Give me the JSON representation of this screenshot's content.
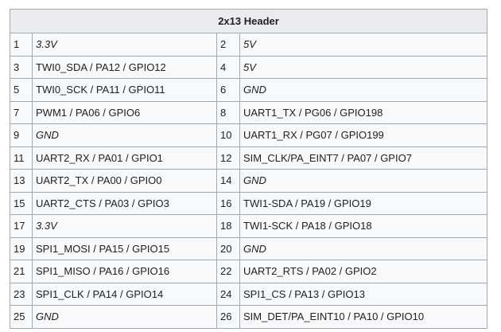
{
  "table": {
    "title": "2x13 Header",
    "rows": [
      [
        {
          "pin": "1",
          "label": "3.3V",
          "italic": true
        },
        {
          "pin": "2",
          "label": "5V",
          "italic": true
        }
      ],
      [
        {
          "pin": "3",
          "label": "TWI0_SDA / PA12 / GPIO12"
        },
        {
          "pin": "4",
          "label": "5V",
          "italic": true
        }
      ],
      [
        {
          "pin": "5",
          "label": "TWI0_SCK / PA11 / GPIO11"
        },
        {
          "pin": "6",
          "label": "GND",
          "italic": true
        }
      ],
      [
        {
          "pin": "7",
          "label": "PWM1 / PA06 / GPIO6"
        },
        {
          "pin": "8",
          "label": "UART1_TX / PG06 / GPIO198"
        }
      ],
      [
        {
          "pin": "9",
          "label": "GND",
          "italic": true
        },
        {
          "pin": "10",
          "label": "UART1_RX / PG07 / GPIO199"
        }
      ],
      [
        {
          "pin": "11",
          "label": "UART2_RX / PA01 / GPIO1"
        },
        {
          "pin": "12",
          "label": "SIM_CLK/PA_EINT7 / PA07 / GPIO7"
        }
      ],
      [
        {
          "pin": "13",
          "label": "UART2_TX / PA00 / GPIO0"
        },
        {
          "pin": "14",
          "label": "GND",
          "italic": true
        }
      ],
      [
        {
          "pin": "15",
          "label": "UART2_CTS / PA03 / GPIO3"
        },
        {
          "pin": "16",
          "label": "TWI1-SDA / PA19 / GPIO19"
        }
      ],
      [
        {
          "pin": "17",
          "label": "3.3V",
          "italic": true
        },
        {
          "pin": "18",
          "label": "TWI1-SCK / PA18 / GPIO18"
        }
      ],
      [
        {
          "pin": "19",
          "label": "SPI1_MOSI / PA15 / GPIO15"
        },
        {
          "pin": "20",
          "label": "GND",
          "italic": true
        }
      ],
      [
        {
          "pin": "21",
          "label": "SPI1_MISO / PA16 / GPIO16"
        },
        {
          "pin": "22",
          "label": "UART2_RTS / PA02 / GPIO2"
        }
      ],
      [
        {
          "pin": "23",
          "label": "SPI1_CLK / PA14 / GPIO14"
        },
        {
          "pin": "24",
          "label": "SPI1_CS / PA13 / GPIO13"
        }
      ],
      [
        {
          "pin": "25",
          "label": "GND",
          "italic": true
        },
        {
          "pin": "26",
          "label": "SIM_DET/PA_EINT10 / PA10 / GPIO10"
        }
      ]
    ]
  }
}
